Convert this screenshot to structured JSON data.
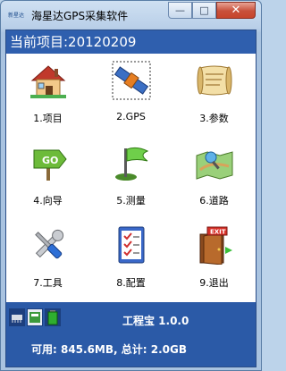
{
  "window": {
    "title": "海星达GPS采集软件",
    "logo_text": "新星达",
    "min_glyph": "—",
    "max_glyph": "□",
    "close_glyph": "✕"
  },
  "project": {
    "label": "当前项目:20120209"
  },
  "menu": [
    {
      "label": "1.项目",
      "icon": "house-icon"
    },
    {
      "label": "2.GPS",
      "icon": "satellite-icon"
    },
    {
      "label": "3.参数",
      "icon": "scroll-icon"
    },
    {
      "label": "4.向导",
      "icon": "go-sign-icon"
    },
    {
      "label": "5.测量",
      "icon": "survey-flag-icon"
    },
    {
      "label": "6.道路",
      "icon": "road-map-icon"
    },
    {
      "label": "7.工具",
      "icon": "wrench-screwdriver-icon"
    },
    {
      "label": "8.配置",
      "icon": "checklist-icon"
    },
    {
      "label": "9.退出",
      "icon": "exit-door-icon"
    }
  ],
  "status": {
    "product": "工程宝 1.0.0",
    "storage": "可用: 845.6MB, 总计: 2.0GB"
  },
  "colors": {
    "accent": "#2f5fae",
    "bottom": "#2b5aa7"
  }
}
